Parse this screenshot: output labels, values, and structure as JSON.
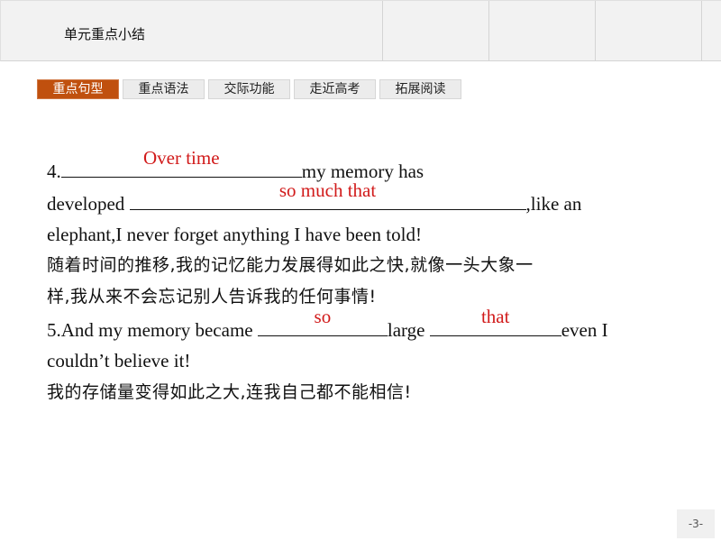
{
  "header": {
    "title": "单元重点小结"
  },
  "tabs": [
    {
      "label": "重点句型",
      "active": true
    },
    {
      "label": "重点语法",
      "active": false
    },
    {
      "label": "交际功能",
      "active": false
    },
    {
      "label": "走近高考",
      "active": false
    },
    {
      "label": "拓展阅读",
      "active": false
    }
  ],
  "content": {
    "item4": {
      "number": "4.",
      "blank1_answer": "Over time",
      "text1": "my memory has",
      "text2": "developed ",
      "blank2_answer": "so much that",
      "text3": ",like an",
      "text4": "elephant,I never forget anything I have been told!",
      "translation_line1": "随着时间的推移,我的记忆能力发展得如此之快,就像一头大象一",
      "translation_line2": "样,我从来不会忘记别人告诉我的任何事情!"
    },
    "item5": {
      "text1": "5.And my memory became ",
      "blank1_answer": "so",
      "text2": "large ",
      "blank2_answer": "that",
      "text3": "even I",
      "text4": "couldn’t believe it!",
      "translation": "我的存储量变得如此之大,连我自己都不能相信!"
    }
  },
  "footer": {
    "page_number": "-3-"
  },
  "colors": {
    "active_tab": "#c0500e",
    "answer_text": "#d11a1a",
    "header_bg": "#f2f2f2"
  }
}
